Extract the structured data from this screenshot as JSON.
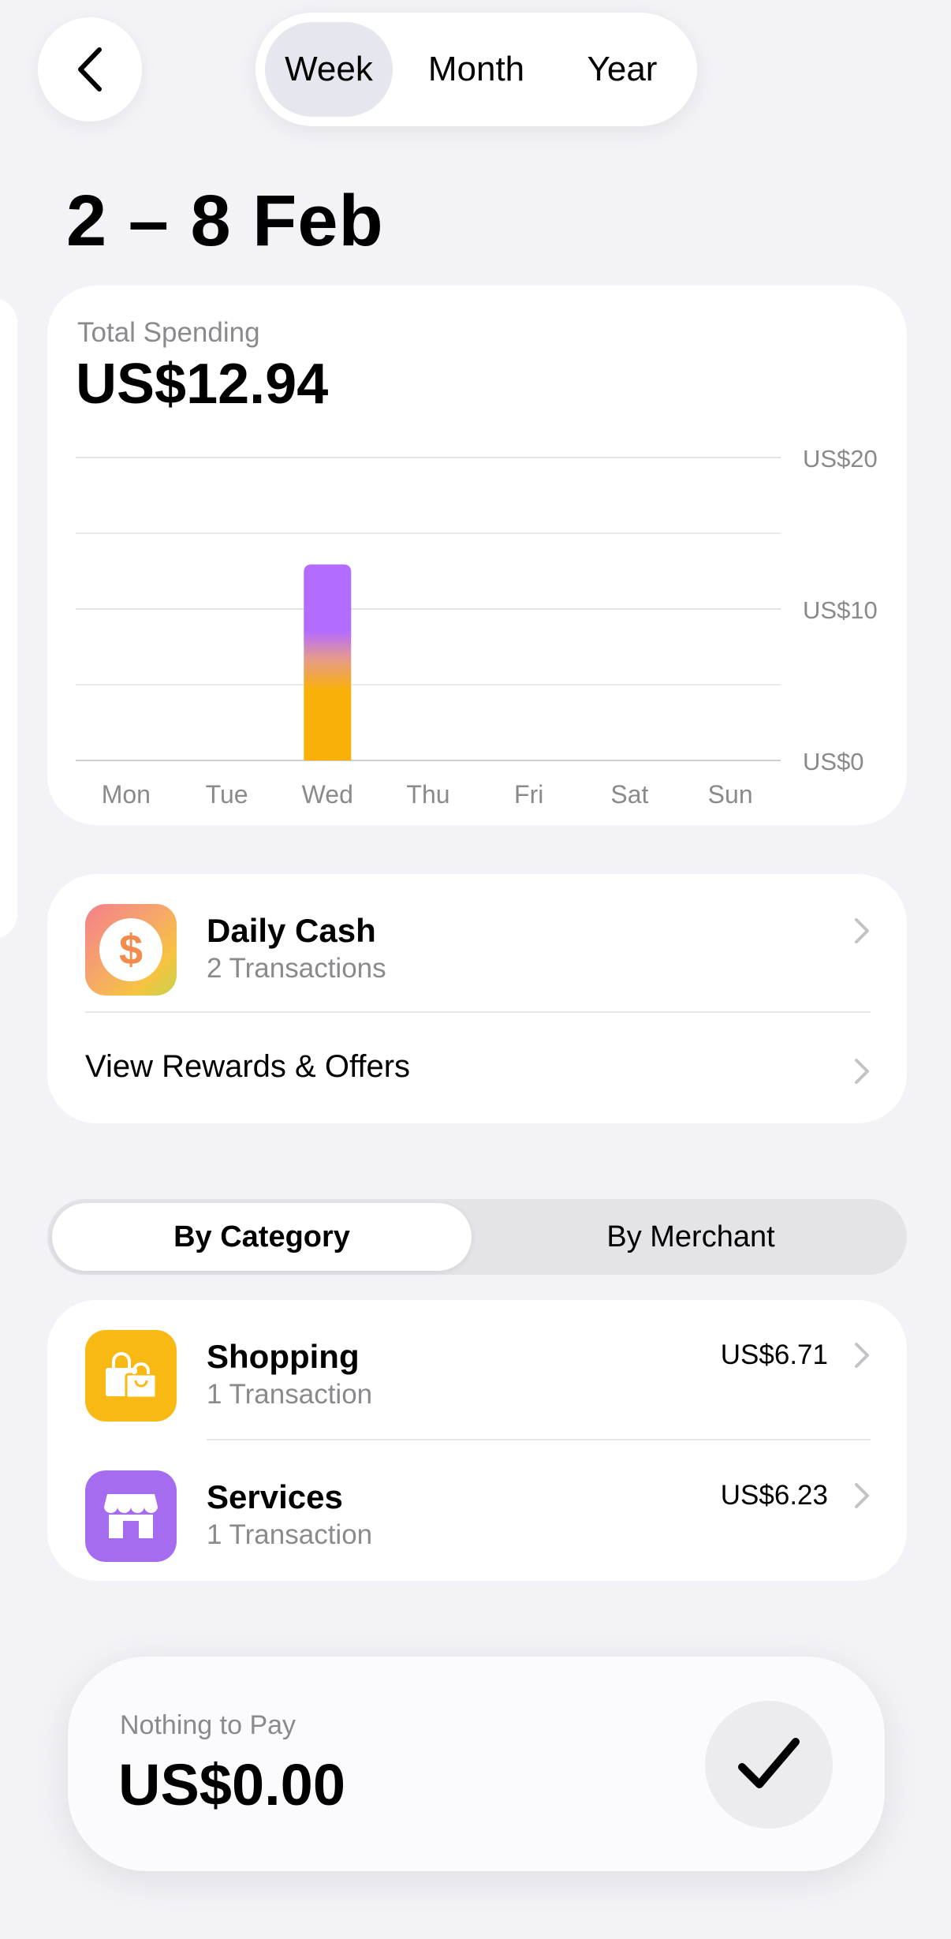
{
  "header": {
    "periods": [
      {
        "label": "Week",
        "selected": true
      },
      {
        "label": "Month",
        "selected": false
      },
      {
        "label": "Year",
        "selected": false
      }
    ],
    "date_range": "2 – 8 Feb"
  },
  "spending": {
    "label": "Total Spending",
    "total": "US$12.94"
  },
  "chart_data": {
    "type": "bar",
    "categories": [
      "Mon",
      "Tue",
      "Wed",
      "Thu",
      "Fri",
      "Sat",
      "Sun"
    ],
    "values": [
      0,
      0,
      12.94,
      0,
      0,
      0,
      0
    ],
    "segments": [
      {
        "name": "Shopping",
        "values": [
          0,
          0,
          6.71,
          0,
          0,
          0,
          0
        ],
        "color": "#f9b10a"
      },
      {
        "name": "Services",
        "values": [
          0,
          0,
          6.23,
          0,
          0,
          0,
          0
        ],
        "color": "#b46bff"
      }
    ],
    "y_ticks": [
      "US$0",
      "US$10",
      "US$20"
    ],
    "ylim": [
      0,
      20
    ],
    "grid": true
  },
  "daily_cash": {
    "title": "Daily Cash",
    "subtitle": "2 Transactions",
    "rewards_label": "View Rewards & Offers"
  },
  "breakdown": {
    "tabs": [
      {
        "label": "By Category",
        "selected": true
      },
      {
        "label": "By Merchant",
        "selected": false
      }
    ],
    "items": [
      {
        "title": "Shopping",
        "subtitle": "1 Transaction",
        "amount": "US$6.71",
        "color": "#f9b915"
      },
      {
        "title": "Services",
        "subtitle": "1 Transaction",
        "amount": "US$6.23",
        "color": "#a56cf0"
      }
    ]
  },
  "payment": {
    "label": "Nothing to Pay",
    "amount": "US$0.00"
  }
}
